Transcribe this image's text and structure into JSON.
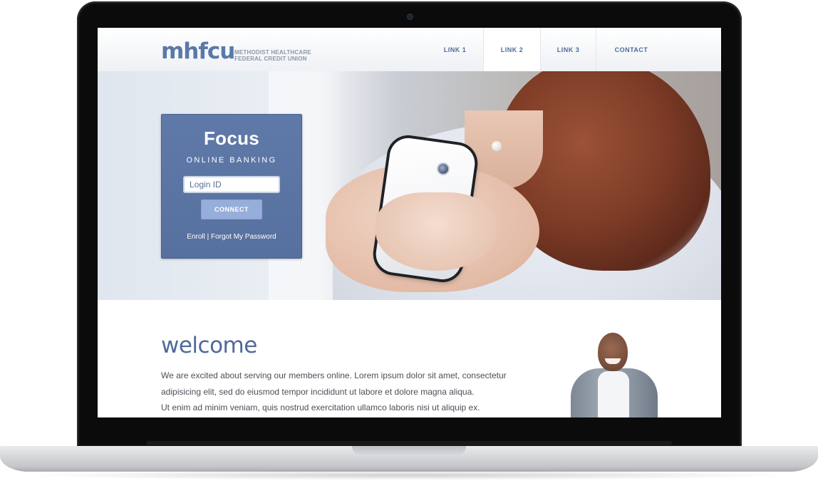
{
  "brand": {
    "logo": "mhfcu",
    "logo_subtitle_line1": "METHODIST HEALTHCARE",
    "logo_subtitle_line2": "FEDERAL CREDIT UNION"
  },
  "nav": {
    "items": [
      {
        "label": "LINK 1"
      },
      {
        "label": "LINK 2"
      },
      {
        "label": "LINK 3"
      },
      {
        "label": "CONTACT"
      }
    ]
  },
  "login": {
    "title": "Focus",
    "subtitle": "ONLINE BANKING",
    "input_placeholder": "Login ID",
    "connect_label": "CONNECT",
    "enroll_label": "Enroll",
    "separator": "|",
    "forgot_label": "Forgot My Password"
  },
  "content": {
    "heading": "welcome",
    "paragraph_line1": "We are excited about serving our members online. Lorem ipsum dolor sit amet, consectetur",
    "paragraph_line2": "adipisicing elit, sed do eiusmod tempor incididunt ut labore et dolore magna aliqua.",
    "paragraph_line3": "Ut enim ad minim veniam, quis nostrud exercitation ullamco laboris nisi ut aliquip ex."
  },
  "colors": {
    "brand_blue": "#5a79a8",
    "panel_blue": "#5f7aa8",
    "button_blue": "#97aedb"
  }
}
